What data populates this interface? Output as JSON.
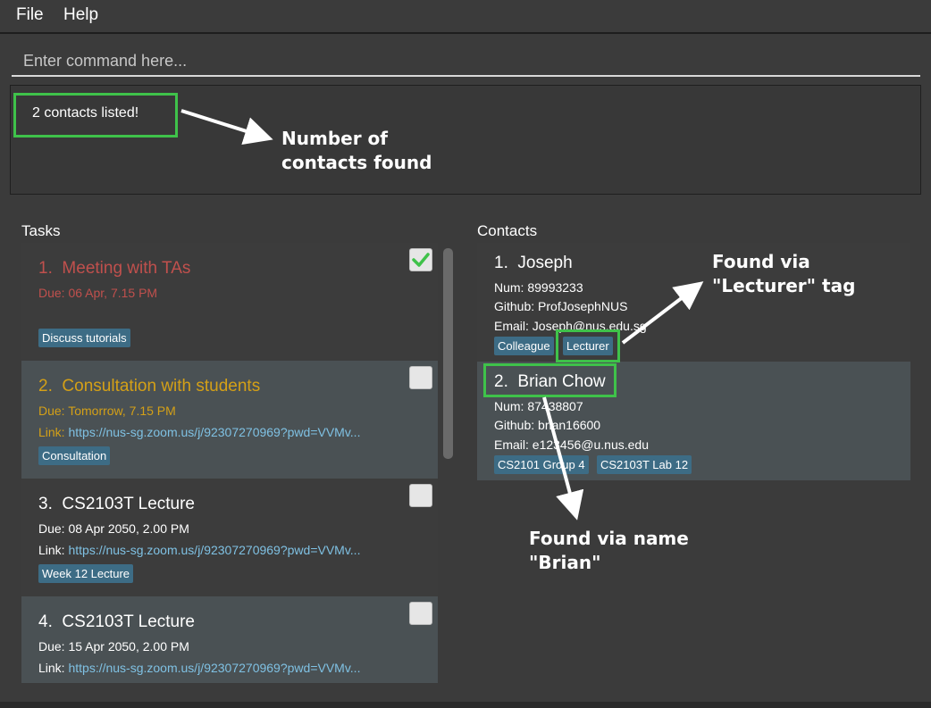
{
  "menu": [
    "File",
    "Help"
  ],
  "command": {
    "placeholder": "Enter command here...",
    "value": ""
  },
  "result": {
    "message": "2 contacts listed!"
  },
  "annotations": {
    "count_line1": "Number of",
    "count_line2": "contacts found",
    "tag_line1": "Found via",
    "tag_line2": "\"Lecturer\" tag",
    "name_line1": "Found via name",
    "name_line2": "\"Brian\""
  },
  "tasks_label": "Tasks",
  "contacts_label": "Contacts",
  "tasks": [
    {
      "index": "1.",
      "title": "Meeting with TAs",
      "due": "Due: 06 Apr, 7.15 PM",
      "link_label": "",
      "link_url": "",
      "tags": [
        "Discuss tutorials"
      ],
      "done": true,
      "status_color": "#c0504d"
    },
    {
      "index": "2.",
      "title": "Consultation with students",
      "due": "Due: Tomorrow, 7.15 PM",
      "link_label": "Link:",
      "link_url": "https://nus-sg.zoom.us/j/92307270969?pwd=VVMv...",
      "tags": [
        "Consultation"
      ],
      "done": false,
      "status_color": "#d4a017"
    },
    {
      "index": "3.",
      "title": "CS2103T Lecture",
      "due": "Due: 08 Apr 2050, 2.00 PM",
      "link_label": "Link:",
      "link_url": "https://nus-sg.zoom.us/j/92307270969?pwd=VVMv...",
      "tags": [
        "Week 12 Lecture"
      ],
      "done": false,
      "status_color": "#ffffff"
    },
    {
      "index": "4.",
      "title": "CS2103T Lecture",
      "due": "Due: 15 Apr 2050, 2.00 PM",
      "link_label": "Link:",
      "link_url": "https://nus-sg.zoom.us/j/92307270969?pwd=VVMv...",
      "tags": [],
      "done": false,
      "status_color": "#ffffff"
    }
  ],
  "contacts": [
    {
      "index": "1.",
      "name": "Joseph",
      "num": "Num: 89993233",
      "github": "Github: ProfJosephNUS",
      "email": "Email: Joseph@nus.edu.sg",
      "tags": [
        "Colleague",
        "Lecturer"
      ]
    },
    {
      "index": "2.",
      "name": "Brian Chow",
      "num": "Num: 87438807",
      "github": "Github: brian16600",
      "email": "Email: e123456@u.nus.edu",
      "tags": [
        "CS2101 Group 4",
        "CS2103T Lab 12"
      ]
    }
  ],
  "colors": {
    "accent_green": "#3fc24a",
    "tag_bg": "#3d6c85",
    "link": "#7fc1e3",
    "overdue": "#c0504d",
    "due_soon": "#d4a017"
  }
}
